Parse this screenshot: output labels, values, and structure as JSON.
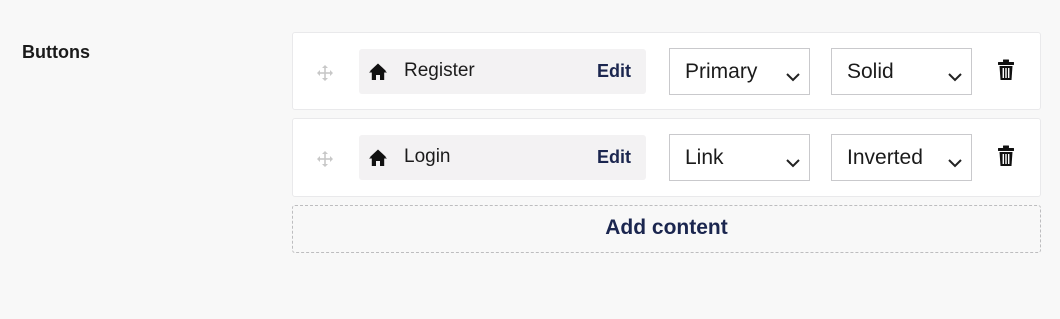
{
  "field": {
    "label": "Buttons"
  },
  "rows": [
    {
      "name": "Register",
      "edit": "Edit",
      "color": "Primary",
      "style": "Solid",
      "link_icon": "home-icon",
      "delete_icon": "trash-icon"
    },
    {
      "name": "Login",
      "edit": "Edit",
      "color": "Link",
      "style": "Inverted",
      "link_icon": "home-icon",
      "delete_icon": "trash-icon"
    }
  ],
  "add_content": "Add content",
  "colors": {
    "accent": "#1b264f",
    "chip_bg": "#f3f2f3",
    "page_bg": "#f8f8f8"
  }
}
